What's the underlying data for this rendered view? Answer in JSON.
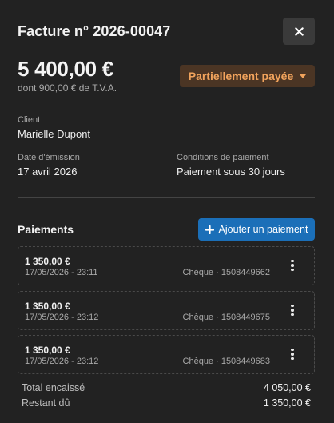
{
  "header": {
    "title": "Facture n° 2026-00047"
  },
  "summary": {
    "amount": "5 400,00 €",
    "vat_note": "dont 900,00 € de T.V.A.",
    "status": "Partiellement payée"
  },
  "details": {
    "client_label": "Client",
    "client_value": "Marielle Dupont",
    "issue_date_label": "Date d'émission",
    "issue_date_value": "17 avril 2026",
    "terms_label": "Conditions de paiement",
    "terms_value": "Paiement sous 30 jours"
  },
  "payments": {
    "title": "Paiements",
    "add_label": "Ajouter un paiement",
    "items": [
      {
        "amount": "1 350,00 €",
        "datetime": "17/05/2026 - 23:11",
        "method": "Chèque · 1508449662"
      },
      {
        "amount": "1 350,00 €",
        "datetime": "17/05/2026 - 23:12",
        "method": "Chèque · 1508449675"
      },
      {
        "amount": "1 350,00 €",
        "datetime": "17/05/2026 - 23:12",
        "method": "Chèque · 1508449683"
      }
    ]
  },
  "totals": {
    "collected_label": "Total encaissé",
    "collected_value": "4 050,00 €",
    "remaining_label": "Restant dû",
    "remaining_value": "1 350,00 €"
  },
  "colors": {
    "background": "#222222",
    "status_bg": "#4b3524",
    "status_text": "#f1a35c",
    "primary_button": "#1b6fb8"
  }
}
